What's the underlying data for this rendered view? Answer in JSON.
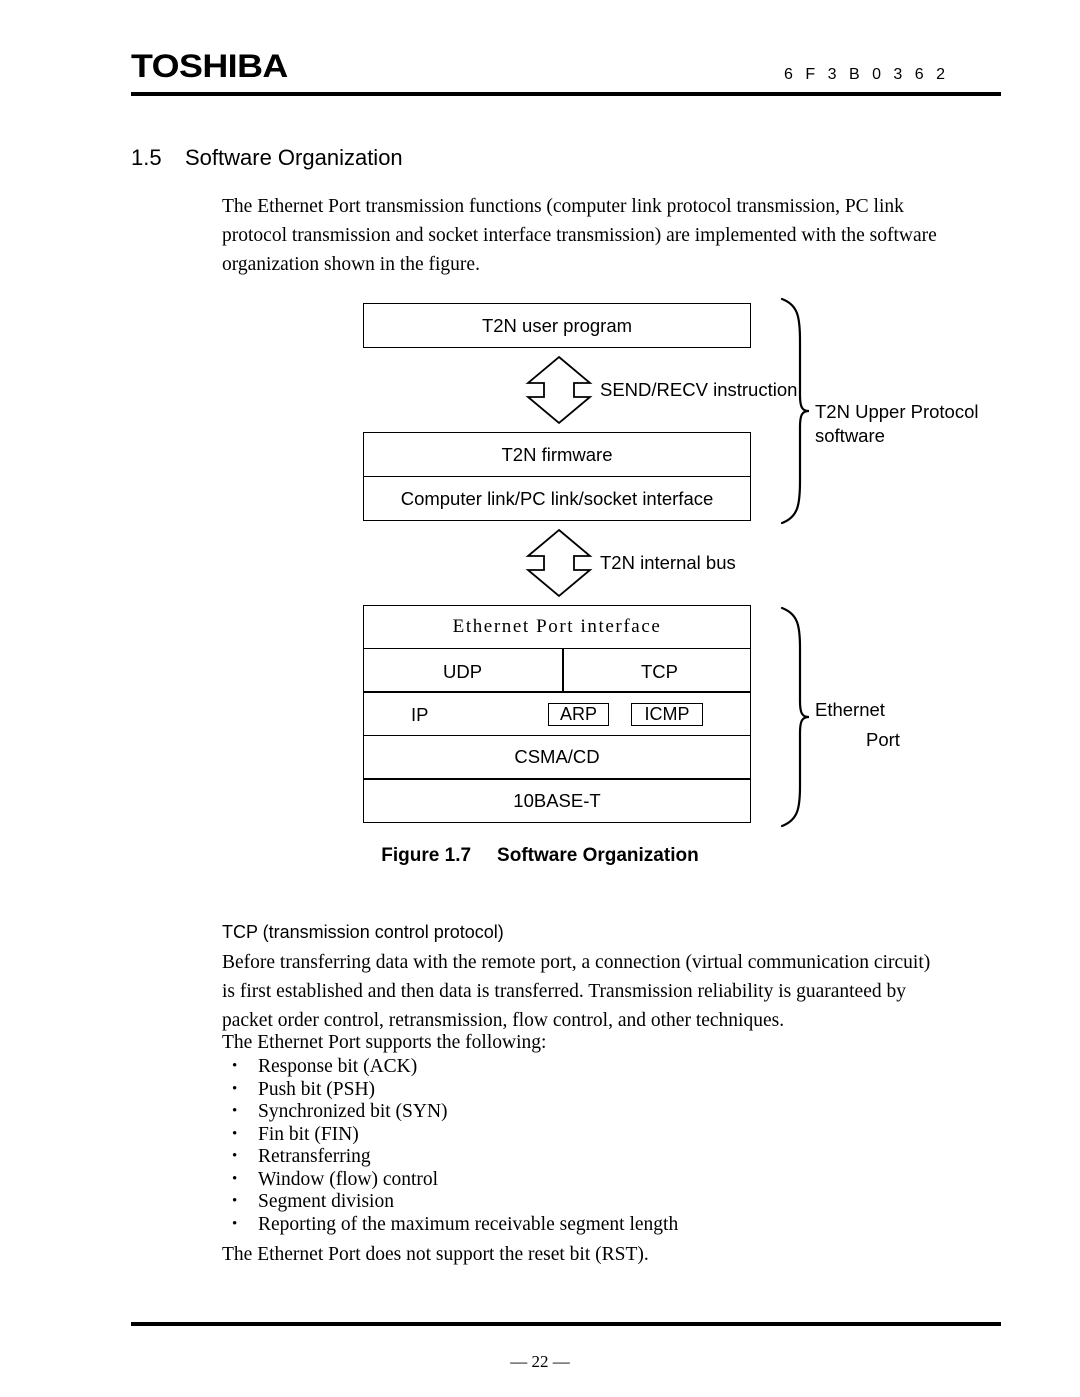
{
  "header": {
    "logo": "TOSHIBA",
    "doc_code": "6 F 3 B 0 3 6 2"
  },
  "section": {
    "number": "1.5",
    "title": "Software Organization"
  },
  "intro_paragraph": "The Ethernet Port transmission functions (computer link protocol transmission, PC link protocol transmission and socket interface transmission) are implemented with the software organization shown in the figure.",
  "figure": {
    "caption_label": "Figure 1.7",
    "caption_title": "Software Organization",
    "boxes": {
      "user_program": "T2N user program",
      "firmware": "T2N firmware",
      "interface_layer": "Computer link/PC link/socket interface",
      "ethernet_port_interface": "Ethernet Port interface",
      "udp": "UDP",
      "tcp": "TCP",
      "ip": "IP",
      "arp": "ARP",
      "icmp": "ICMP",
      "csma_cd": "CSMA/CD",
      "base10t": "10BASE-T"
    },
    "arrow_labels": {
      "send_recv": "SEND/RECV instruction",
      "internal_bus": "T2N internal bus"
    },
    "brace_labels": {
      "upper_protocol_line1": "T2N Upper Protocol",
      "upper_protocol_line2": "software",
      "ethernet_line1": "Ethernet",
      "ethernet_line2": "Port"
    }
  },
  "tcp_section": {
    "heading": "TCP (transmission control protocol)",
    "paragraph": "Before transferring data with the remote port, a connection (virtual communication circuit) is first established and then data is transferred. Transmission reliability is guaranteed by packet order control, retransmission, flow control, and other techniques.",
    "supports_intro": "The Ethernet Port supports the following:",
    "bullet_marker": "•",
    "bullets": [
      "Response bit (ACK)",
      "Push bit (PSH)",
      "Synchronized bit (SYN)",
      "Fin bit (FIN)",
      "Retransferring",
      "Window (flow) control",
      "Segment division",
      "Reporting of the maximum receivable segment length"
    ],
    "closing": "The Ethernet Port does not support the reset bit (RST)."
  },
  "footer": {
    "page_number": "— 22 —"
  }
}
